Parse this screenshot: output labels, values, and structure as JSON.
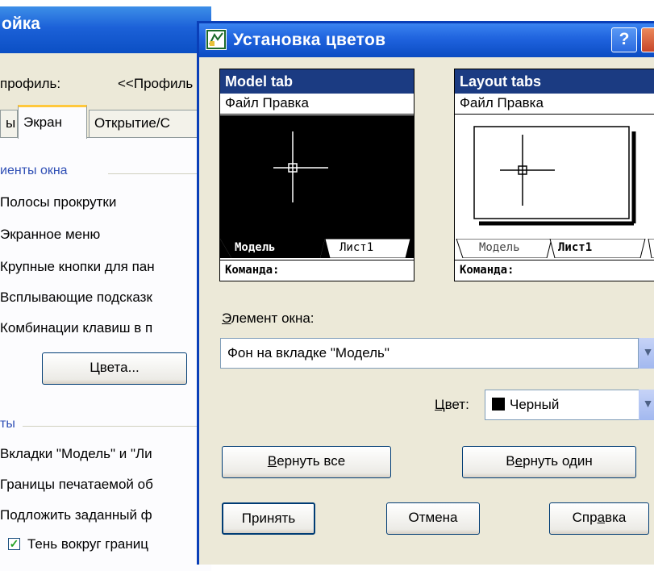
{
  "background_window": {
    "title": "ойка",
    "profile_label": "профиль:",
    "profile_value": "<<Профиль",
    "tabs": [
      {
        "label": "ы"
      },
      {
        "label": "Экран"
      },
      {
        "label": "Открытие/С"
      }
    ],
    "group1_title": "иенты окна",
    "group1_items": [
      "Полосы прокрутки",
      "Экранное меню",
      "Крупные кнопки для пан",
      "Всплывающие подсказк",
      "Комбинации клавиш в п"
    ],
    "colors_button": "Цвета...",
    "group2_title": "ты",
    "group2_items": [
      "Вкладки \"Модель\" и \"Ли",
      "Границы печатаемой об",
      "Подложить заданный ф"
    ],
    "checkbox_label": "Тень вокруг границ",
    "checkbox_checked": true
  },
  "dialog": {
    "title": "Установка цветов",
    "help_label": "?",
    "model_preview": {
      "header": "Model tab",
      "menu": "Файл  Правка",
      "tab_active": "Модель",
      "tab_inactive": "Лист1",
      "command": "Команда:",
      "background": "#000000"
    },
    "layout_preview": {
      "header": "Layout tabs",
      "menu": "Файл  Правка",
      "tab_inactive": "Модель",
      "tab_active": "Лист1",
      "command": "Команда:"
    },
    "element_label_u": "Э",
    "element_label_rest": "лемент окна:",
    "element_value": "Фон на вкладке \"Модель\"",
    "color_label_u": "Ц",
    "color_label_rest": "вет:",
    "color_value": "Черный",
    "color_swatch": "#000000",
    "restore_all_u": "В",
    "restore_all_rest": "ернуть все",
    "restore_one_pre": "В",
    "restore_one_u": "е",
    "restore_one_rest": "рнуть один",
    "accept": "Принять",
    "cancel": "Отмена",
    "help_pre": "Спр",
    "help_u": "а",
    "help_rest": "вка"
  },
  "colors": {
    "titlebar": "#1f63de",
    "dialog_bg": "#ece9d8",
    "preview_header": "#1b3b82"
  }
}
